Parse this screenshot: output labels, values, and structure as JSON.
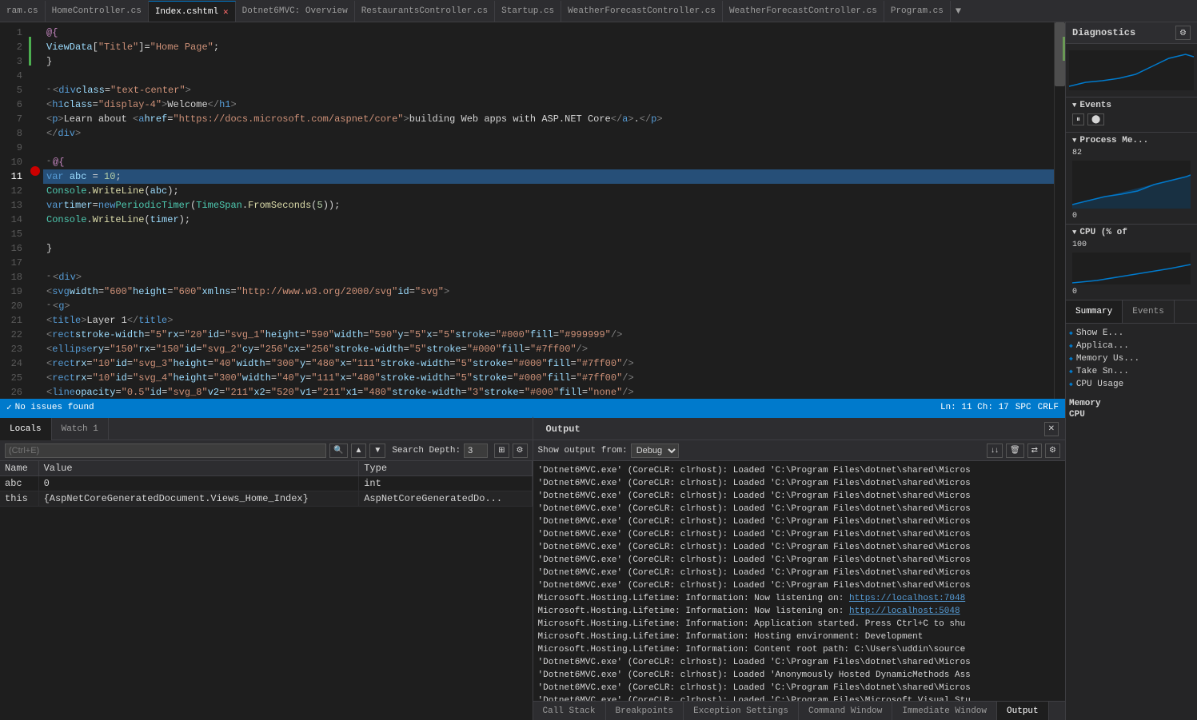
{
  "tabs": [
    {
      "label": "ram.cs",
      "active": false,
      "modified": false
    },
    {
      "label": "HomeController.cs",
      "active": false,
      "modified": false
    },
    {
      "label": "Index.cshtml",
      "active": true,
      "modified": true
    },
    {
      "label": "Dotnet6MVC: Overview",
      "active": false,
      "modified": false
    },
    {
      "label": "RestaurantsController.cs",
      "active": false,
      "modified": false
    },
    {
      "label": "Startup.cs",
      "active": false,
      "modified": false
    },
    {
      "label": "WeatherForecastController.cs",
      "active": false,
      "modified": false
    },
    {
      "label": "WeatherForecastController.cs",
      "active": false,
      "modified": false
    },
    {
      "label": "Program.cs",
      "active": false,
      "modified": false
    }
  ],
  "code_lines": [
    {
      "num": 1,
      "content": "@{",
      "type": "normal"
    },
    {
      "num": 2,
      "content": "    ViewData[\"Title\"] = \"Home Page\";",
      "type": "normal"
    },
    {
      "num": 3,
      "content": "}",
      "type": "normal"
    },
    {
      "num": 4,
      "content": "",
      "type": "normal"
    },
    {
      "num": 5,
      "content": "-<div class=\"text-center\">",
      "type": "normal"
    },
    {
      "num": 6,
      "content": "    <h1 class=\"display-4\">Welcome</h1>",
      "type": "normal"
    },
    {
      "num": 7,
      "content": "    <p>Learn about <a href=\"https://docs.microsoft.com/aspnet/core\">building Web apps with ASP.NET Core</a>.</p>",
      "type": "normal"
    },
    {
      "num": 8,
      "content": "</div>",
      "type": "normal"
    },
    {
      "num": 9,
      "content": "",
      "type": "normal"
    },
    {
      "num": 10,
      "content": "-@{",
      "type": "normal"
    },
    {
      "num": 11,
      "content": "    var abc = 10;",
      "type": "highlighted"
    },
    {
      "num": 12,
      "content": "    Console.WriteLine(abc);",
      "type": "normal"
    },
    {
      "num": 13,
      "content": "    var timer = new PeriodicTimer(TimeSpan.FromSeconds(5));",
      "type": "normal"
    },
    {
      "num": 14,
      "content": "    Console.WriteLine(timer);",
      "type": "normal"
    },
    {
      "num": 15,
      "content": "",
      "type": "normal"
    },
    {
      "num": 16,
      "content": "}",
      "type": "normal"
    },
    {
      "num": 17,
      "content": "",
      "type": "normal"
    },
    {
      "num": 18,
      "content": "-<div>",
      "type": "normal"
    },
    {
      "num": 19,
      "content": "    <svg width=\"600\" height=\"600\" xmlns=\"http://www.w3.org/2000/svg\" id=\"svg\">",
      "type": "normal"
    },
    {
      "num": 20,
      "content": "        <g>",
      "type": "normal"
    },
    {
      "num": 21,
      "content": "            <title>Layer 1</title>",
      "type": "normal"
    },
    {
      "num": 22,
      "content": "            <rect stroke-width=\"5\" rx=\"20\" id=\"svg_1\" height=\"590\" width=\"590\" y=\"5\" x=\"5\" stroke=\"#000\" fill=\"#999999\" />",
      "type": "normal"
    },
    {
      "num": 23,
      "content": "            <ellipse ry=\"150\" rx=\"150\" id=\"svg_2\" cy=\"256\" cx=\"256\" stroke-width=\"5\" stroke=\"#000\" fill=\"#7ff00\" />",
      "type": "normal"
    },
    {
      "num": 24,
      "content": "            <rect rx=\"10\" id=\"svg_3\" height=\"40\" width=\"300\" y=\"480\" x=\"111\" stroke-width=\"5\" stroke=\"#000\" fill=\"#7ff00\" />",
      "type": "normal"
    },
    {
      "num": 25,
      "content": "            <rect rx=\"10\" id=\"svg_4\" height=\"300\" width=\"40\" y=\"111\" x=\"480\" stroke-width=\"5\" stroke=\"#000\" fill=\"#7ff00\" />",
      "type": "normal"
    },
    {
      "num": 26,
      "content": "            <line opacity=\"0.5\" id=\"svg_8\" v2=\"211\" x2=\"520\" v1=\"211\" x1=\"480\" stroke-width=\"3\" stroke=\"#000\" fill=\"none\" />",
      "type": "normal"
    }
  ],
  "status_bar": {
    "icon": "✓",
    "message": "No issues found",
    "position": "Ln: 11  Ch: 17",
    "spaces": "SPC",
    "encoding": "CRLF"
  },
  "watch_panel": {
    "toolbar": {
      "search_placeholder": "(Ctrl+E)",
      "search_depth_label": "Search Depth:",
      "search_depth_value": "3"
    },
    "columns": [
      "Name",
      "Value",
      "Type"
    ],
    "rows": [
      {
        "name": "abc",
        "value": "0",
        "type": "int"
      },
      {
        "name": "this",
        "value": "{AspNetCoreGeneratedDocument.Views_Home_Index}",
        "type": "AspNetCoreGeneratedDo..."
      }
    ]
  },
  "output_panel": {
    "title": "Output",
    "show_output_label": "Show output from:",
    "source": "Debug",
    "lines": [
      "'Dotnet6MVC.exe' (CoreCLR: clrhost): Loaded 'C:\\Program Files\\dotnet\\shared\\Micros",
      "'Dotnet6MVC.exe' (CoreCLR: clrhost): Loaded 'C:\\Program Files\\dotnet\\shared\\Micros",
      "'Dotnet6MVC.exe' (CoreCLR: clrhost): Loaded 'C:\\Program Files\\dotnet\\shared\\Micros",
      "'Dotnet6MVC.exe' (CoreCLR: clrhost): Loaded 'C:\\Program Files\\dotnet\\shared\\Micros",
      "'Dotnet6MVC.exe' (CoreCLR: clrhost): Loaded 'C:\\Program Files\\dotnet\\shared\\Micros",
      "'Dotnet6MVC.exe' (CoreCLR: clrhost): Loaded 'C:\\Program Files\\dotnet\\shared\\Micros",
      "'Dotnet6MVC.exe' (CoreCLR: clrhost): Loaded 'C:\\Program Files\\dotnet\\shared\\Micros",
      "'Dotnet6MVC.exe' (CoreCLR: clrhost): Loaded 'C:\\Program Files\\dotnet\\shared\\Micros",
      "'Dotnet6MVC.exe' (CoreCLR: clrhost): Loaded 'C:\\Program Files\\dotnet\\shared\\Micros",
      "'Dotnet6MVC.exe' (CoreCLR: clrhost): Loaded 'C:\\Program Files\\dotnet\\shared\\Micros",
      "Microsoft.Hosting.Lifetime: Information: Now listening on: https://localhost:7048",
      "Microsoft.Hosting.Lifetime: Information: Now listening on: http://localhost:5048",
      "Microsoft.Hosting.Lifetime: Information: Application started. Press Ctrl+C to shu",
      "Microsoft.Hosting.Lifetime: Information: Hosting environment: Development",
      "Microsoft.Hosting.Lifetime: Information: Content root path: C:\\Users\\uddin\\source",
      "'Dotnet6MVC.exe' (CoreCLR: clrhost): Loaded 'C:\\Program Files\\dotnet\\shared\\Micros",
      "'Dotnet6MVC.exe' (CoreCLR: clrhost): Loaded 'Anonymously Hosted DynamicMethods Ass",
      "'Dotnet6MVC.exe' (CoreCLR: clrhost): Loaded 'C:\\Program Files\\dotnet\\shared\\Micros",
      "'Dotnet6MVC.exe' (CoreCLR: clrhost): Loaded 'C:\\Program Files\\Microsoft Visual Stu"
    ]
  },
  "diagnostics": {
    "title": "Diagnostics",
    "events_section": "Events",
    "process_memory_section": "Process Me...",
    "process_memory_value": "82",
    "process_memory_min": "0",
    "cpu_section": "CPU (% of",
    "cpu_value": "100",
    "cpu_min": "0",
    "summary_tab": "Summary",
    "events_tab": "Events",
    "items": [
      "Show E...",
      "Applica...",
      "Memory Us...",
      "Take Sn...",
      "CPU Usage"
    ]
  },
  "bottom_tabs": [
    "Locals",
    "Watch 1"
  ],
  "output_bottom_tabs": [
    "Call Stack",
    "Breakpoints",
    "Exception Settings",
    "Command Window",
    "Immediate Window",
    "Output"
  ]
}
